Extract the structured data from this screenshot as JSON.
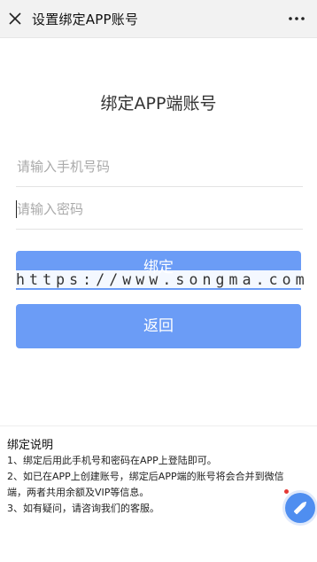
{
  "header": {
    "title": "设置绑定APP账号",
    "close_icon": "close-icon",
    "more_icon": "more-dots-icon"
  },
  "main": {
    "title": "绑定APP端账号",
    "phone_placeholder": "请输入手机号码",
    "password_placeholder": "请输入密码",
    "bind_label": "绑定",
    "back_label": "返回",
    "watermark": "https://www.songma.com"
  },
  "notes": {
    "title": "绑定说明",
    "line1": "1、绑定后用此手机号和密码在APP上登陆即可。",
    "line2a": "2、如已在APP上创建账号，绑定后APP端的账号将会合并到微信",
    "line2b": "端，两者共用余额及VIP等信息。",
    "line3": "3、如有疑问，请咨询我们的客服。"
  },
  "colors": {
    "accent": "#6b9cf6",
    "float_button": "#4f8ef0",
    "badge": "#e53935"
  },
  "float_icon": "edit-icon"
}
